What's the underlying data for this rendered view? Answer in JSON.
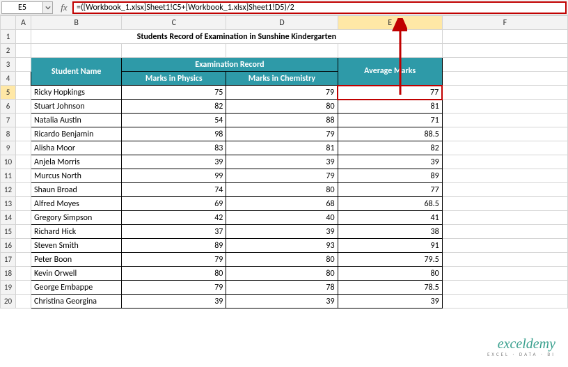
{
  "namebox": "E5",
  "formula": "=([Workbook_1.xlsx]Sheet1!C5+[Workbook_1.xlsx]Sheet1!D5)/2",
  "columns": [
    "A",
    "B",
    "C",
    "D",
    "E",
    "F"
  ],
  "title": "Students Record of Examination in Sunshine Kindergarten",
  "header": {
    "student": "Student Name",
    "exam": "Examination Record",
    "physics": "Marks in Physics",
    "chemistry": "Marks in Chemistry",
    "average": "Average Marks"
  },
  "rows": [
    {
      "n": "5",
      "name": "Ricky Hopkings",
      "p": "75",
      "c": "79",
      "a": "77"
    },
    {
      "n": "6",
      "name": "Stuart Johnson",
      "p": "82",
      "c": "80",
      "a": "81"
    },
    {
      "n": "7",
      "name": "Natalia Austin",
      "p": "54",
      "c": "88",
      "a": "71"
    },
    {
      "n": "8",
      "name": "Ricardo Benjamin",
      "p": "98",
      "c": "79",
      "a": "88.5"
    },
    {
      "n": "9",
      "name": "Alisha Moor",
      "p": "83",
      "c": "81",
      "a": "82"
    },
    {
      "n": "10",
      "name": "Anjela Morris",
      "p": "39",
      "c": "39",
      "a": "39"
    },
    {
      "n": "11",
      "name": "Murcus North",
      "p": "99",
      "c": "79",
      "a": "89"
    },
    {
      "n": "12",
      "name": "Shaun Broad",
      "p": "74",
      "c": "80",
      "a": "77"
    },
    {
      "n": "13",
      "name": "Alfred Moyes",
      "p": "69",
      "c": "68",
      "a": "68.5"
    },
    {
      "n": "14",
      "name": "Gregory Simpson",
      "p": "42",
      "c": "40",
      "a": "41"
    },
    {
      "n": "15",
      "name": "Richard Hick",
      "p": "37",
      "c": "39",
      "a": "38"
    },
    {
      "n": "16",
      "name": "Steven Smith",
      "p": "89",
      "c": "93",
      "a": "91"
    },
    {
      "n": "17",
      "name": "Peter Boon",
      "p": "79",
      "c": "80",
      "a": "79.5"
    },
    {
      "n": "18",
      "name": "Kevin Orwell",
      "p": "80",
      "c": "80",
      "a": "80"
    },
    {
      "n": "19",
      "name": "George Embappe",
      "p": "79",
      "c": "78",
      "a": "78.5"
    },
    {
      "n": "20",
      "name": "Christina Georgina",
      "p": "39",
      "c": "39",
      "a": "39"
    }
  ],
  "watermark": {
    "main": "exceldemy",
    "sub": "EXCEL · DATA · BI"
  }
}
